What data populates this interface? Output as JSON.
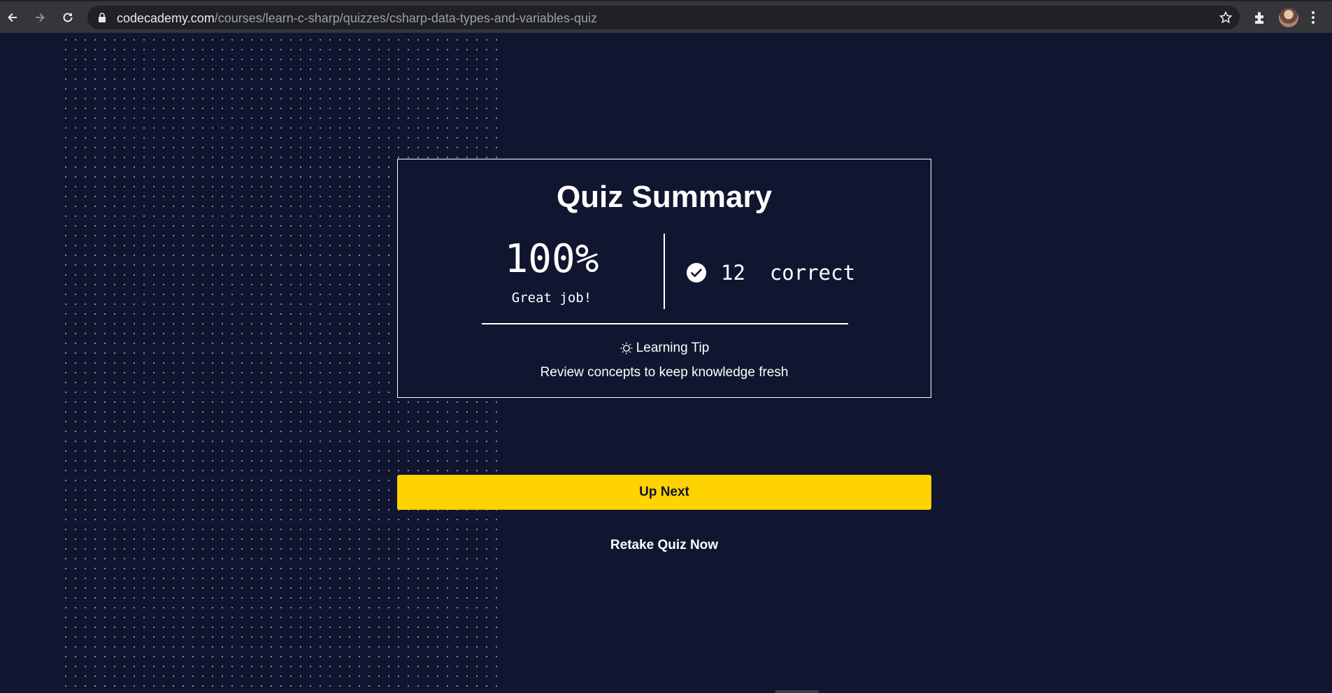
{
  "browser": {
    "url_domain": "codecademy.com",
    "url_path": "/courses/learn-c-sharp/quizzes/csharp-data-types-and-variables-quiz",
    "icons": [
      "back-icon",
      "forward-icon",
      "reload-icon",
      "lock-icon",
      "star-icon",
      "extensions-icon",
      "avatar",
      "menu-icon"
    ]
  },
  "summary": {
    "title": "Quiz Summary",
    "score_percent": "100%",
    "score_message": "Great job!",
    "correct_count": "12  correct",
    "tip_label": "Learning Tip",
    "tip_text": "Review concepts to keep knowledge fresh"
  },
  "actions": {
    "up_next_label": "Up Next",
    "retake_label": "Retake Quiz Now"
  },
  "colors": {
    "page_bg": "#10162f",
    "accent_yellow": "#ffd300",
    "text": "#ffffff"
  }
}
